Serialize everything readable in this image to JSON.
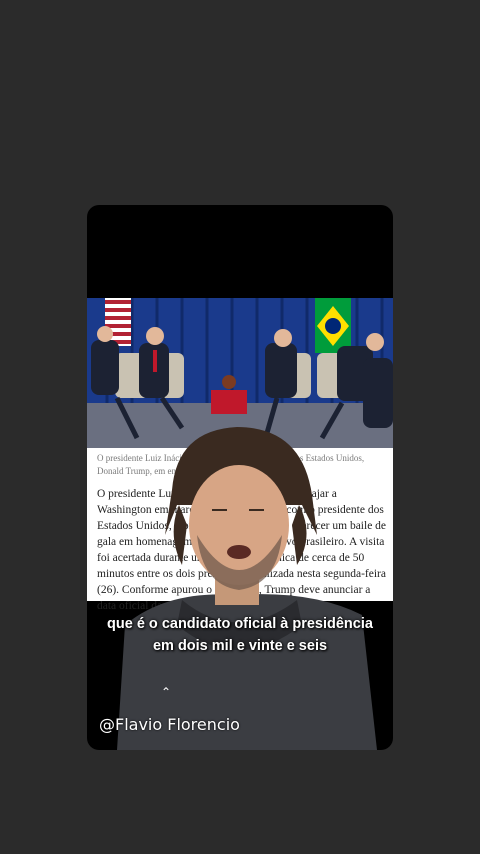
{
  "article": {
    "caption": "O presidente Luiz Inácio Lula da Silva e o presidente dos Estados Unidos, Donald Trump, em encontro – Divulgação/PR",
    "body": "O presidente Luiz Inácio Lula da Silva deve viajar a Washington em março para um encontro com o presidente dos Estados Unidos, Donald Trump, que deve oferecer um baile de gala em homenagem ao chefe do Executivo brasileiro. A visita foi acertada durante uma ligação telefônica de cerca de 50 minutos entre os dois presidentes realizada nesta segunda-feira (26). Conforme apurou o Poder360, Trump deve anunciar a data oficial da viagem em breve..."
  },
  "overlay": {
    "subtitle": "que é o candidato oficial à presidência em dois mil e vinte e seis",
    "handle": "@Flavio Florencio"
  },
  "colors": {
    "background": "#2b2b2b",
    "subtitle": "#ffffff"
  }
}
